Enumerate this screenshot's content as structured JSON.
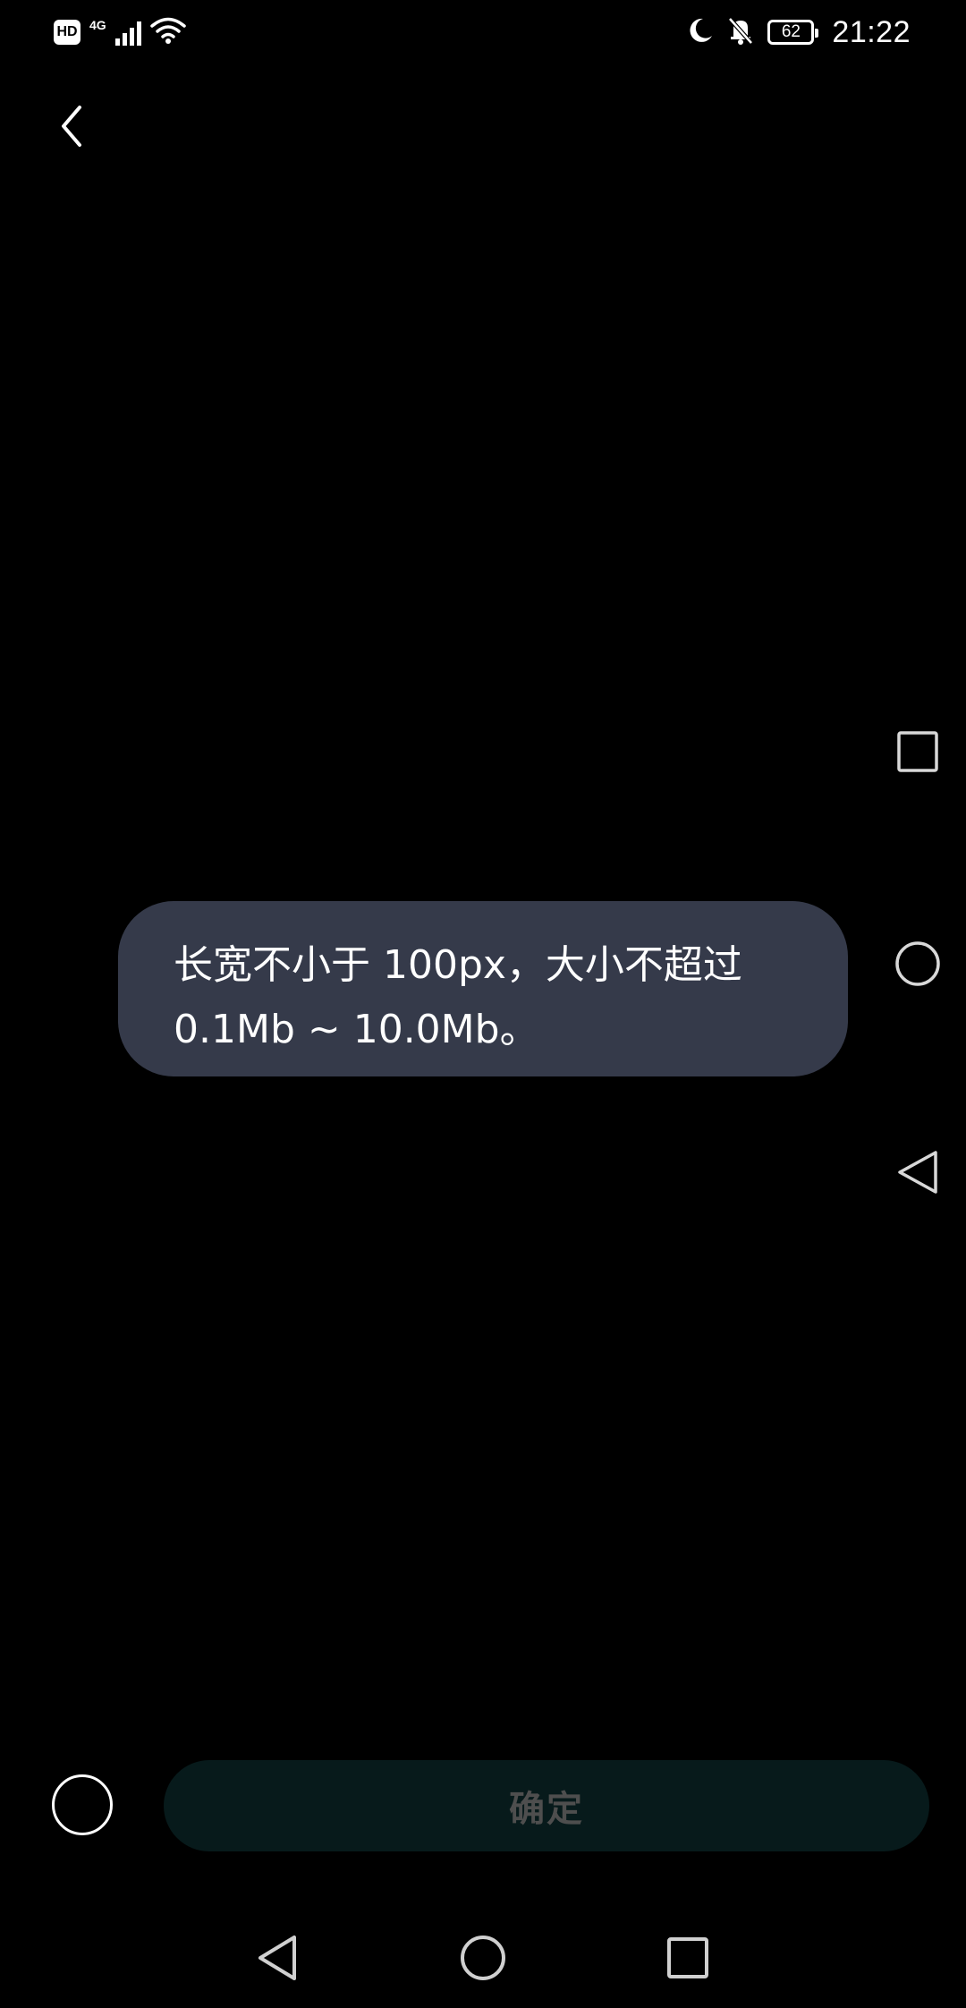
{
  "status_bar": {
    "hd_label": "HD",
    "network_label": "4G",
    "battery_level": "62",
    "time": "21:22",
    "icons": [
      "hd-icon",
      "signal-icon",
      "wifi-icon",
      "moon-icon",
      "notifications-off-icon",
      "battery-icon"
    ]
  },
  "toolbar": {
    "back_icon": "chevron-left-icon"
  },
  "toast": {
    "text": "长宽不小于 100px，大小不超过 0.1Mb ~ 10.0Mb。"
  },
  "footer": {
    "confirm_label": "确定",
    "select_icon": "radio-circle-icon"
  },
  "side_controls": [
    "square-icon",
    "circle-icon",
    "triangle-back-icon"
  ],
  "nav_bar": [
    "back-triangle-icon",
    "home-circle-icon",
    "recents-square-icon"
  ],
  "colors": {
    "background": "#000000",
    "toast_background": "#353a4a",
    "confirm_button_background": "#071a1b",
    "confirm_label": "#4e4e4e"
  }
}
